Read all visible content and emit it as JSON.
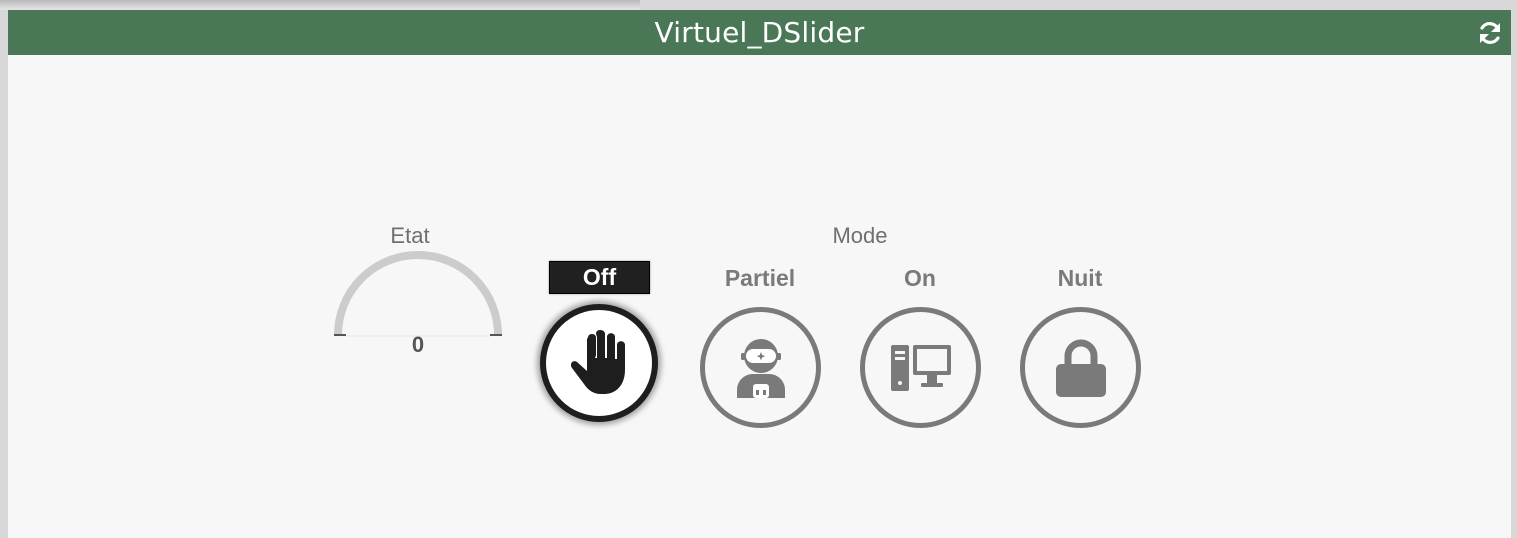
{
  "header": {
    "title": "Virtuel_DSlider",
    "refresh_icon": "refresh-icon"
  },
  "etat": {
    "label": "Etat",
    "value": "0",
    "gauge_fraction": 0
  },
  "mode": {
    "label": "Mode",
    "selected": "Off",
    "options": [
      {
        "label": "Off",
        "icon": "hand-stop-icon",
        "active": true
      },
      {
        "label": "Partiel",
        "icon": "astronaut-icon",
        "active": false
      },
      {
        "label": "On",
        "icon": "desktop-computer-icon",
        "active": false
      },
      {
        "label": "Nuit",
        "icon": "lock-icon",
        "active": false
      }
    ]
  },
  "colors": {
    "header_bg": "#4a7856",
    "active": "#1e1e1e",
    "inactive": "#7a7a7a",
    "gauge_track": "#cccccc"
  }
}
